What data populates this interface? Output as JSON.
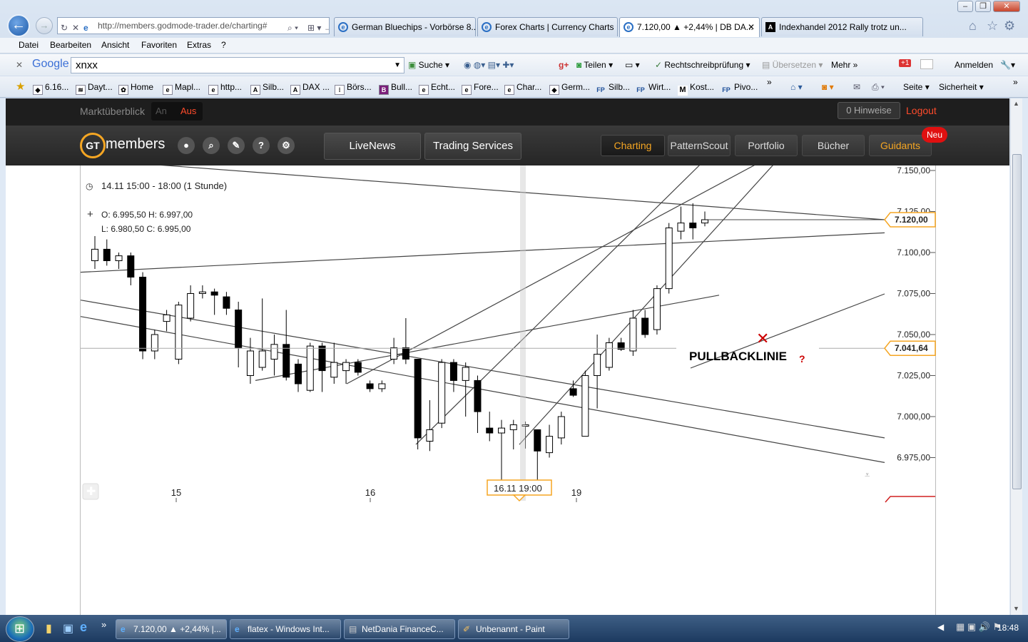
{
  "browser": {
    "url": "http://members.godmode-trader.de/charting#",
    "tabs": [
      {
        "label": "German Bluechips - Vorbörse 8..."
      },
      {
        "label": "Forex Charts | Currency Charts"
      },
      {
        "label": "7.120,00 ▲ +2,44% | DB DA...",
        "active": true
      },
      {
        "label": "Indexhandel 2012 Rally trotz un..."
      }
    ],
    "menu": [
      "Datei",
      "Bearbeiten",
      "Ansicht",
      "Favoriten",
      "Extras",
      "?"
    ],
    "google_toolbar": {
      "logo": "Google",
      "search_value": "xnxx",
      "suche": "Suche",
      "teilen": "Teilen",
      "rechtschreib": "Rechtschreibprüfung",
      "uebersetzen": "Übersetzen",
      "mehr": "Mehr »",
      "anmelden": "Anmelden",
      "gplus": "+1"
    },
    "favorites": [
      "6.16...",
      "Dayt...",
      "Home",
      "Mapl...",
      "http...",
      "Silb...",
      "DAX ...",
      "Börs...",
      "Bull...",
      "Echt...",
      "Fore...",
      "Char...",
      "Germ...",
      "Silb...",
      "Wirt...",
      "Kost...",
      "Pivo..."
    ],
    "command_bar": {
      "seite": "Seite",
      "sicherheit": "Sicherheit"
    }
  },
  "site": {
    "marktueberblick": "Marktüberblick",
    "toggle_on": "An",
    "toggle_off": "Aus",
    "hinweise": "0 Hinweise",
    "logout": "Logout",
    "logo_gt": "GT",
    "logo_members": "members",
    "nav_left": [
      "LiveNews",
      "Trading Services"
    ],
    "nav_right": [
      "Charting",
      "PatternScout",
      "Portfolio",
      "Bücher",
      "Guidants"
    ],
    "neu_badge": "Neu"
  },
  "chart_data": {
    "type": "candlestick",
    "interval_label": "14.11 15:00 - 18:00 (1 Stunde)",
    "ohlc_o": "O: 6.995,50 H: 6.997,00",
    "ohlc_l": "L:  6.980,50 C: 6.995,00",
    "y_ticks": [
      "7.150,00",
      "7.125,00",
      "7.100,00",
      "7.075,00",
      "7.050,00",
      "7.025,00",
      "7.000,00",
      "6.975,00"
    ],
    "y_tick_values": [
      7150,
      7125,
      7100,
      7075,
      7050,
      7025,
      7000,
      6975
    ],
    "x_ticks": [
      "15",
      "16",
      "19"
    ],
    "last_price_label": "7.120,00",
    "last_price": 7120,
    "crosshair_price_label": "7.041,64",
    "crosshair_price": 7041.64,
    "crosshair_time_label": "16.11 19:00",
    "annotation": "PULLBACKLINIE",
    "annotation_mark": "?",
    "colors": {
      "up": "#ffffff",
      "down": "#000000",
      "accent": "#f5a623",
      "annotation": "#cc0000"
    },
    "candles": [
      [
        7095,
        7110,
        7090,
        7102
      ],
      [
        7102,
        7108,
        7092,
        7095
      ],
      [
        7095,
        7100,
        7090,
        7098
      ],
      [
        7098,
        7100,
        7080,
        7085
      ],
      [
        7085,
        7088,
        7035,
        7040
      ],
      [
        7040,
        7053,
        7035,
        7050
      ],
      [
        7058,
        7065,
        7052,
        7062
      ],
      [
        7035,
        7070,
        7032,
        7068
      ],
      [
        7060,
        7080,
        7058,
        7075
      ],
      [
        7075,
        7080,
        7072,
        7076
      ],
      [
        7076,
        7078,
        7062,
        7074
      ],
      [
        7073,
        7076,
        7062,
        7066
      ],
      [
        7065,
        7070,
        7030,
        7042
      ],
      [
        7025,
        7048,
        7020,
        7040
      ],
      [
        7030,
        7072,
        7028,
        7040
      ],
      [
        7035,
        7050,
        7025,
        7044
      ],
      [
        7044,
        7065,
        7022,
        7024
      ],
      [
        7032,
        7035,
        7015,
        7020
      ],
      [
        7016,
        7045,
        7015,
        7043
      ],
      [
        7043,
        7045,
        7015,
        7028
      ],
      [
        7024,
        7045,
        7020,
        7033
      ],
      [
        7028,
        7035,
        7020,
        7033
      ],
      [
        7033,
        7035,
        7025,
        7027
      ],
      [
        7020,
        7022,
        7015,
        7017
      ],
      [
        7017,
        7022,
        7015,
        7020
      ],
      [
        7035,
        7048,
        7032,
        7042
      ],
      [
        7042,
        7060,
        7032,
        7035
      ],
      [
        7035,
        6990,
        6980,
        6987
      ],
      [
        6985,
        7010,
        6979,
        6992
      ],
      [
        6996,
        7035,
        6993,
        7033
      ],
      [
        7033,
        7035,
        7015,
        7022
      ],
      [
        7022,
        7033,
        7000,
        7030
      ],
      [
        7022,
        7025,
        6990,
        7003
      ],
      [
        6993,
        7003,
        6985,
        6990
      ],
      [
        6990,
        6998,
        6960,
        6993
      ],
      [
        6992,
        6998,
        6980,
        6995
      ],
      [
        6995,
        6997,
        6980.5,
        6995
      ],
      [
        6992,
        6992,
        6960,
        6979
      ],
      [
        6978,
        6995,
        6975,
        6988
      ],
      [
        6987,
        7003,
        6983,
        7000
      ],
      [
        7017,
        7022,
        7012,
        7013
      ],
      [
        6988,
        7028,
        6988,
        7025
      ],
      [
        7025,
        7050,
        7005,
        7038
      ],
      [
        7030,
        7048,
        7028,
        7045
      ],
      [
        7045,
        7048,
        7040,
        7041
      ],
      [
        7040,
        7065,
        7037,
        7060
      ],
      [
        7060,
        7065,
        7048,
        7050
      ],
      [
        7053,
        7080,
        7050,
        7078
      ],
      [
        7078,
        7118,
        7075,
        7115
      ],
      [
        7113,
        7128,
        7108,
        7118
      ],
      [
        7118,
        7130,
        7108,
        7115
      ],
      [
        7118,
        7125,
        7116,
        7120
      ]
    ],
    "lines": [
      [
        7157,
        7120
      ],
      [
        7088,
        7112
      ],
      [
        7071,
        6987
      ],
      [
        7061,
        6972
      ],
      [
        7022,
        7074
      ],
      [
        7020,
        7165
      ],
      [
        6983,
        7165
      ],
      [
        6983,
        7165
      ]
    ]
  },
  "taskbar": {
    "items": [
      "7.120,00 ▲ +2,44% |...",
      "flatex - Windows Int...",
      "NetDania FinanceC...",
      "Unbenannt - Paint"
    ],
    "clock": "18:48"
  }
}
